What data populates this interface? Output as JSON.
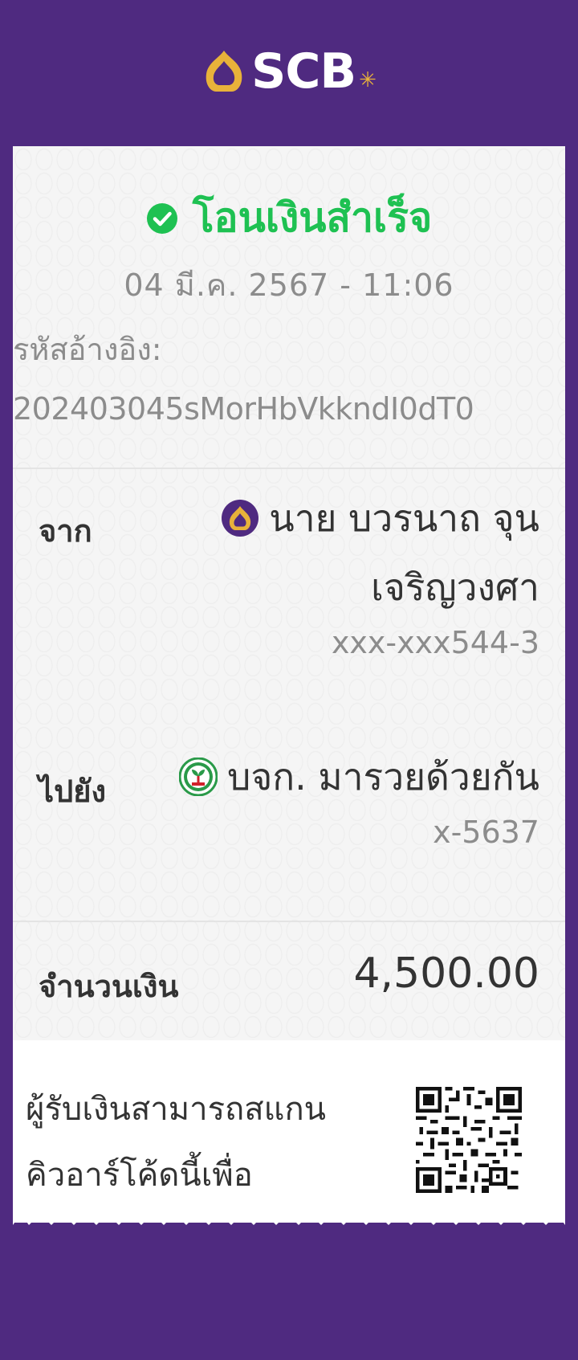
{
  "brand": {
    "name": "SCB"
  },
  "status": {
    "text": "โอนเงินสำเร็จ",
    "color": "#1ec152"
  },
  "transaction": {
    "datetime": "04 มี.ค. 2567 - 11:06",
    "ref_label": "รหัสอ้างอิง:",
    "ref_value": "202403045sMorHbVkkndI0dT0"
  },
  "from": {
    "label": "จาก",
    "name_line1": "นาย บวรนาถ จุน",
    "name_line2": "เจริญวงศา",
    "account": "xxx-xxx544-3",
    "bank_icon": "scb-bank-icon"
  },
  "to": {
    "label": "ไปยัง",
    "name": "บจก. มารวยด้วยกัน",
    "account": "x-5637",
    "bank_icon": "kbank-icon"
  },
  "amount": {
    "label": "จำนวนเงิน",
    "value": "4,500.00"
  },
  "qr_note": {
    "line1": "ผู้รับเงินสามารถสแกน",
    "line2": "คิวอาร์โค้ดนี้เพื่อ"
  },
  "colors": {
    "background": "#4f2a80",
    "accent": "#e8b23a",
    "success": "#1ec152"
  }
}
